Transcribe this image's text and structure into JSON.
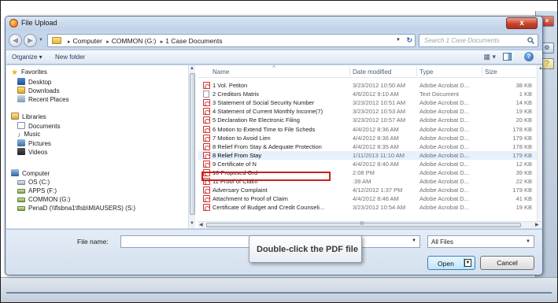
{
  "window": {
    "title": "File Upload",
    "close_glyph": "x"
  },
  "address": {
    "path": [
      "Computer",
      "COMMON (G:)",
      "1 Case Documents"
    ],
    "search_placeholder": "Search 1 Case Documents"
  },
  "toolbar": {
    "organize": "Organize ▾",
    "new_folder": "New folder"
  },
  "nav": {
    "favorites": {
      "label": "Favorites",
      "items": [
        "Desktop",
        "Downloads",
        "Recent Places"
      ]
    },
    "libraries": {
      "label": "Libraries",
      "items": [
        "Documents",
        "Music",
        "Pictures",
        "Videos"
      ]
    },
    "computer": {
      "label": "Computer",
      "items": [
        "OS (C:)",
        "APPS (F:)",
        "COMMON (G:)",
        "PenaD (\\\\flsbna1\\flsb\\MIAUSERS) (S:)"
      ]
    }
  },
  "columns": {
    "name": "Name",
    "date": "Date modified",
    "type": "Type",
    "size": "Size"
  },
  "files": [
    {
      "name": "1 Vol. Petiton",
      "date": "3/23/2012 10:50 AM",
      "type": "Adobe Acrobat D...",
      "size": "38 KB",
      "icon": "pdf-icon"
    },
    {
      "name": "2 Creditors Matrix",
      "date": "4/6/2012 9:10 AM",
      "type": "Text Document",
      "size": "1 KB",
      "icon": "text-file-icon"
    },
    {
      "name": "3 Statement of Social Security Number",
      "date": "3/23/2012 10:51 AM",
      "type": "Adobe Acrobat D...",
      "size": "14 KB",
      "icon": "pdf-icon"
    },
    {
      "name": "4 Statement of Current Monthly Income(7)",
      "date": "3/23/2012 10:53 AM",
      "type": "Adobe Acrobat D...",
      "size": "19 KB",
      "icon": "pdf-icon"
    },
    {
      "name": "5 Declaration Re Electronic Filing",
      "date": "3/23/2012 10:57 AM",
      "type": "Adobe Acrobat D...",
      "size": "20 KB",
      "icon": "pdf-icon"
    },
    {
      "name": "6 Motion to Extend Time to File Scheds",
      "date": "4/4/2012 8:36 AM",
      "type": "Adobe Acrobat D...",
      "size": "178 KB",
      "icon": "pdf-icon"
    },
    {
      "name": "7 Motion to Avoid Lien",
      "date": "4/4/2012 8:36 AM",
      "type": "Adobe Acrobat D...",
      "size": "179 KB",
      "icon": "pdf-icon"
    },
    {
      "name": "8 Relief From Stay & Adequate Protection",
      "date": "4/4/2012 8:35 AM",
      "type": "Adobe Acrobat D...",
      "size": "178 KB",
      "icon": "pdf-icon"
    },
    {
      "name": "8 Relief From Stay",
      "date": "1/11/2013 11:10 AM",
      "type": "Adobe Acrobat D...",
      "size": "179 KB",
      "icon": "pdf-icon",
      "selected": true
    },
    {
      "name": "9 Certificate of N",
      "date": "4/4/2012 8:40 AM",
      "type": "Adobe Acrobat D...",
      "size": "12 KB",
      "icon": "pdf-icon"
    },
    {
      "name": "10 Proposed Ord",
      "date": "2:08 PM",
      "type": "Adobe Acrobat D...",
      "size": "39 KB",
      "icon": "pdf-icon"
    },
    {
      "name": "11 Proof of Claim",
      "date": ":39 AM",
      "type": "Adobe Acrobat D...",
      "size": "22 KB",
      "icon": "pdf-icon"
    },
    {
      "name": "Adversary Complaint",
      "date": "4/12/2012 1:37 PM",
      "type": "Adobe Acrobat D...",
      "size": "179 KB",
      "icon": "pdf-icon"
    },
    {
      "name": "Attachment to Proof of Claim",
      "date": "4/4/2012 8:46 AM",
      "type": "Adobe Acrobat D...",
      "size": "41 KB",
      "icon": "pdf-icon"
    },
    {
      "name": "Certificate of Budget and Credit Counseli...",
      "date": "3/23/2012 10:54 AM",
      "type": "Adobe Acrobat D...",
      "size": "19 KB",
      "icon": "pdf-icon"
    }
  ],
  "tooltip": "Double-click the PDF file",
  "bottom": {
    "file_name_label": "File name:",
    "file_name_value": "",
    "filter": "All Files",
    "open": "Open",
    "cancel": "Cancel"
  },
  "background": {
    "help_glyph": "?"
  },
  "colors": {
    "selection_outline": "#cc1f1f",
    "selected_row_bg": "#e6f1fc",
    "chrome": "#c6d6ea"
  }
}
